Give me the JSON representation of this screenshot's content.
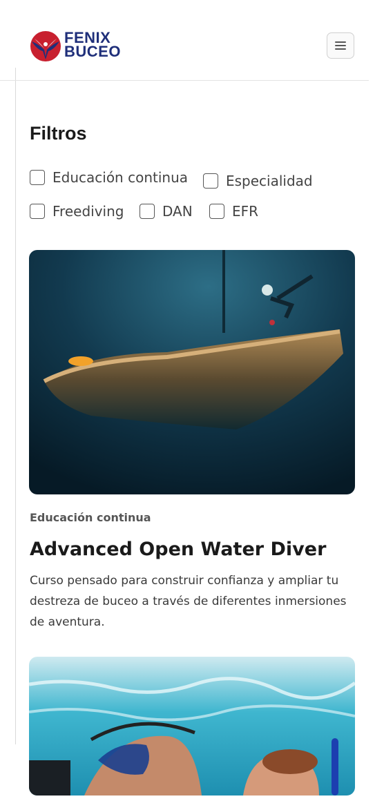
{
  "brand": {
    "line1": "FENIX",
    "line2": "BUCEO",
    "color": "#1f2f7a",
    "accent": "#c8202f"
  },
  "header": {
    "menu_icon": "hamburger-icon"
  },
  "filters": {
    "title": "Filtros",
    "options": [
      {
        "label": "Educación continua",
        "checked": false
      },
      {
        "label": "Especialidad",
        "checked": false
      },
      {
        "label": "Freediving",
        "checked": false
      },
      {
        "label": "DAN",
        "checked": false
      },
      {
        "label": "EFR",
        "checked": false
      }
    ]
  },
  "courses": [
    {
      "category": "Educación continua",
      "title": "Advanced Open Water Diver",
      "description": "Curso pensado para construir confianza y ampliar tu destreza de buceo a través de diferentes inmersiones de aventura."
    },
    {}
  ]
}
